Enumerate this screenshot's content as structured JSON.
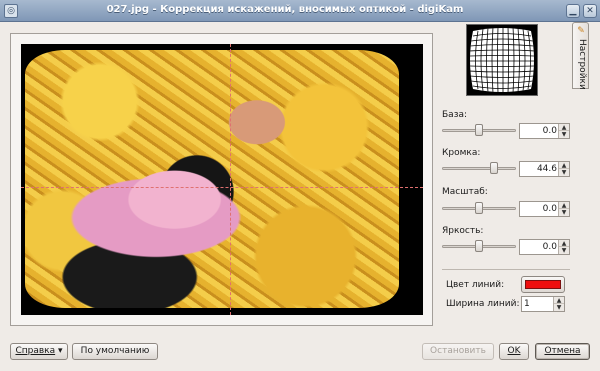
{
  "window": {
    "title": "027.jpg - Коррекция искажений, вносимых оптикой - digiKam",
    "icons": {
      "app": "digikam-app-icon",
      "minimize": "minimize-icon",
      "close": "close-icon"
    }
  },
  "side_tab": {
    "label": "Настройки",
    "icon": "settings-icon"
  },
  "settings": {
    "base": {
      "label": "База:",
      "value": "0.0"
    },
    "edge": {
      "label": "Кромка:",
      "value": "44.6"
    },
    "scale": {
      "label": "Масштаб:",
      "value": "0.0"
    },
    "brightness": {
      "label": "Яркость:",
      "value": "0.0"
    },
    "line_color": {
      "label": "Цвет линий:",
      "color": "#ef0f0f"
    },
    "line_width": {
      "label": "Ширина линий:",
      "value": "1"
    }
  },
  "buttons": {
    "help": "Справка",
    "defaults": "По умолчанию",
    "stop": "Остановить",
    "ok": "OK",
    "cancel": "Отмена"
  }
}
